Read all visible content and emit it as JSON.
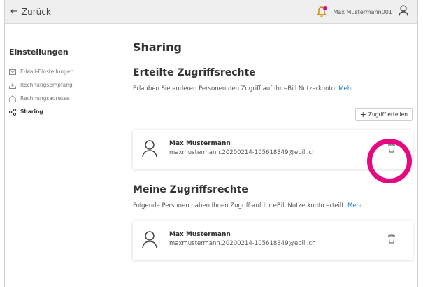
{
  "topbar": {
    "back_label": "Zurück",
    "username": "Max Mustermann001",
    "icons": [
      "bell-icon",
      "user-icon"
    ],
    "notification_color": "#e4097f"
  },
  "sidebar": {
    "title": "Einstellungen",
    "items": [
      {
        "label": "E-Mail-Einstellungen",
        "icon": "mail-icon"
      },
      {
        "label": "Rechnungsempfang",
        "icon": "download-icon"
      },
      {
        "label": "Rechnungsadresse",
        "icon": "home-icon"
      },
      {
        "label": "Sharing",
        "icon": "share-icon",
        "active": true
      }
    ]
  },
  "main": {
    "title": "Sharing",
    "granted": {
      "heading": "Erteilte Zugriffsrechte",
      "description": "Erlauben Sie anderen Personen den Zugriff auf Ihr eBill Nutzerkonto.",
      "more_link": "Mehr",
      "grant_button": "Zugriff erteilen",
      "entries": [
        {
          "name": "Max Mustermann",
          "email": "maxmustermann.20200214-105618349@ebill.ch"
        }
      ]
    },
    "mine": {
      "heading": "Meine Zugriffsrechte",
      "description": "Folgende Personen haben Ihnen Zugriff auf Ihr eBill Nutzerkonto erteilt.",
      "more_link": "Mehr",
      "entries": [
        {
          "name": "Max Mustermann",
          "email": "maxmustermann.20200214-105618349@ebill.ch"
        }
      ]
    }
  },
  "highlight_color": "#e4097f"
}
